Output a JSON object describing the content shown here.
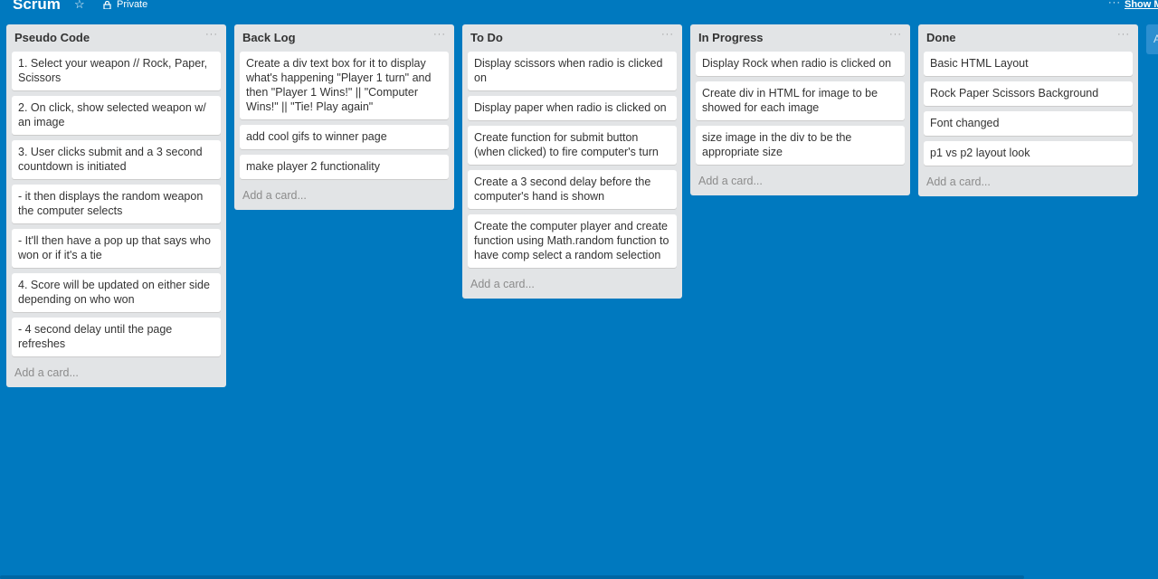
{
  "board": {
    "title": "Scrum",
    "star_icon": "star-icon",
    "privacy_label": "Private",
    "menu_dots": "···",
    "show_menu_label": "Show Menu"
  },
  "lists": [
    {
      "title": "Pseudo Code",
      "menu": "···",
      "cards": [
        "1. Select your weapon // Rock, Paper, Scissors",
        "2. On click, show selected weapon w/ an image",
        "3. User clicks submit and a 3 second countdown is initiated",
        "- it then displays the random weapon the computer selects",
        "- It'll then have a pop up that says who won or if it's a tie",
        "4. Score will be updated on either side depending on who won",
        "- 4 second delay until the page refreshes"
      ],
      "add_card": "Add a card..."
    },
    {
      "title": "Back Log",
      "menu": "···",
      "cards": [
        "Create a div text box for it to display what's happening \"Player 1 turn\" and then \"Player 1 Wins!\" || \"Computer Wins!\" || \"Tie! Play again\"",
        "add cool gifs to winner page",
        "make player 2 functionality"
      ],
      "add_card": "Add a card..."
    },
    {
      "title": "To Do",
      "menu": "···",
      "cards": [
        "Display scissors when radio is clicked on",
        "Display paper when radio is clicked on",
        "Create function for submit button (when clicked) to fire computer's turn",
        "Create a 3 second delay before the computer's hand is shown",
        "Create the computer player and create function using Math.random function to have comp select a random selection"
      ],
      "add_card": "Add a card..."
    },
    {
      "title": "In Progress",
      "menu": "···",
      "cards": [
        "Display Rock when radio is clicked on",
        "Create div in HTML for image to be showed for each image",
        "size image in the div to be the appropriate size"
      ],
      "add_card": "Add a card..."
    },
    {
      "title": "Done",
      "menu": "···",
      "cards": [
        "Basic HTML Layout",
        "Rock Paper Scissors Background",
        "Font changed",
        "p1 vs p2 layout look"
      ],
      "add_card": "Add a card..."
    }
  ],
  "partial_list_label": "A",
  "colors": {
    "background": "#0079bf",
    "list_background": "#e2e4e6",
    "card_background": "#ffffff"
  }
}
